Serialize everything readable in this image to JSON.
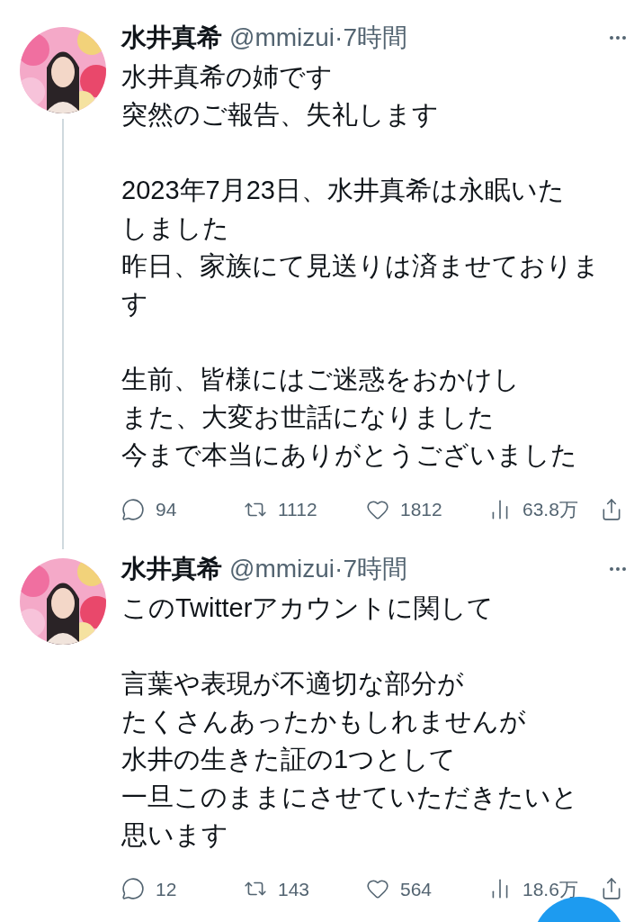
{
  "tweets": [
    {
      "name": "水井真希",
      "handle": "@mmizui",
      "separator": "·",
      "time": "7時間",
      "thread_line": true,
      "paragraphs": [
        [
          "水井真希の姉です",
          "突然のご報告、失礼します"
        ],
        [
          "2023年7月23日、水井真希は永眠いた",
          "しました",
          "昨日、家族にて見送りは済ませておりま",
          "す"
        ],
        [
          "生前、皆様にはご迷惑をおかけし",
          "また、大変お世話になりました",
          "今まで本当にありがとうございました"
        ]
      ],
      "replies": "94",
      "retweets": "1112",
      "likes": "1812",
      "views": "63.8万"
    },
    {
      "name": "水井真希",
      "handle": "@mmizui",
      "separator": "·",
      "time": "7時間",
      "thread_line": false,
      "paragraphs": [
        [
          "このTwitterアカウントに関して"
        ],
        [
          "言葉や表現が不適切な部分が",
          "たくさんあったかもしれませんが",
          "水井の生きた証の1つとして",
          "一旦このままにさせていただきたいと",
          "思います"
        ]
      ],
      "replies": "12",
      "retweets": "143",
      "likes": "564",
      "views": "18.6万"
    }
  ],
  "compose_button": true
}
